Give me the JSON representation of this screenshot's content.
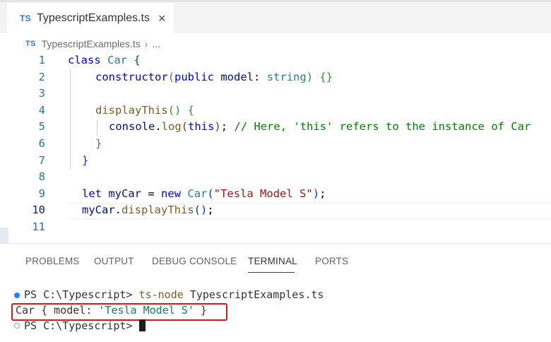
{
  "tab": {
    "icon": "TS",
    "title": "TypescriptExamples.ts",
    "close": "×"
  },
  "breadcrumb": {
    "icon": "TS",
    "file": "TypescriptExamples.ts",
    "separator": "›",
    "more": "..."
  },
  "editor": {
    "active_line": 10,
    "line_numbers": [
      "1",
      "2",
      "3",
      "4",
      "5",
      "6",
      "7",
      "8",
      "9",
      "10",
      "11"
    ],
    "lines": {
      "l1": {
        "kw": "class",
        "cls": "Car",
        "brace": "{"
      },
      "l2": {
        "fn": "constructor",
        "open": "(",
        "kw": "public",
        "param": "model",
        "colon": ":",
        "type": "string",
        "close": ")",
        "body": "{}"
      },
      "l4": {
        "fn": "displayThis",
        "parens": "()",
        "brace": "{"
      },
      "l5": {
        "obj": "console",
        "dot": ".",
        "fn": "log",
        "open": "(",
        "kw": "this",
        "close": ")",
        "semi": ";",
        "comment": "// Here, 'this' refers to the instance of Car"
      },
      "l6": {
        "brace": "}"
      },
      "l7": {
        "brace": "}"
      },
      "l9": {
        "kw": "let",
        "var": "myCar",
        "eq": "=",
        "kw2": "new",
        "cls": "Car",
        "open": "(",
        "str": "\"Tesla Model S\"",
        "close": ")",
        "semi": ";"
      },
      "l10": {
        "var": "myCar",
        "dot": ".",
        "fn": "displayThis",
        "parens": "()",
        "semi": ";"
      }
    }
  },
  "panel": {
    "tabs": [
      "PROBLEMS",
      "OUTPUT",
      "DEBUG CONSOLE",
      "TERMINAL",
      "PORTS"
    ],
    "active_tab": "TERMINAL"
  },
  "terminal": {
    "line1": {
      "prompt": "PS C:\\Typescript>",
      "command": "ts-node",
      "arg": "TypescriptExamples.ts"
    },
    "line2": {
      "prefix": "Car { model: ",
      "value": "'Tesla Model S'",
      "suffix": " }"
    },
    "line3": {
      "prompt": "PS C:\\Typescript>"
    }
  },
  "colors": {
    "highlight_box": "#d11a1a",
    "ts_icon": "#3178c6"
  }
}
